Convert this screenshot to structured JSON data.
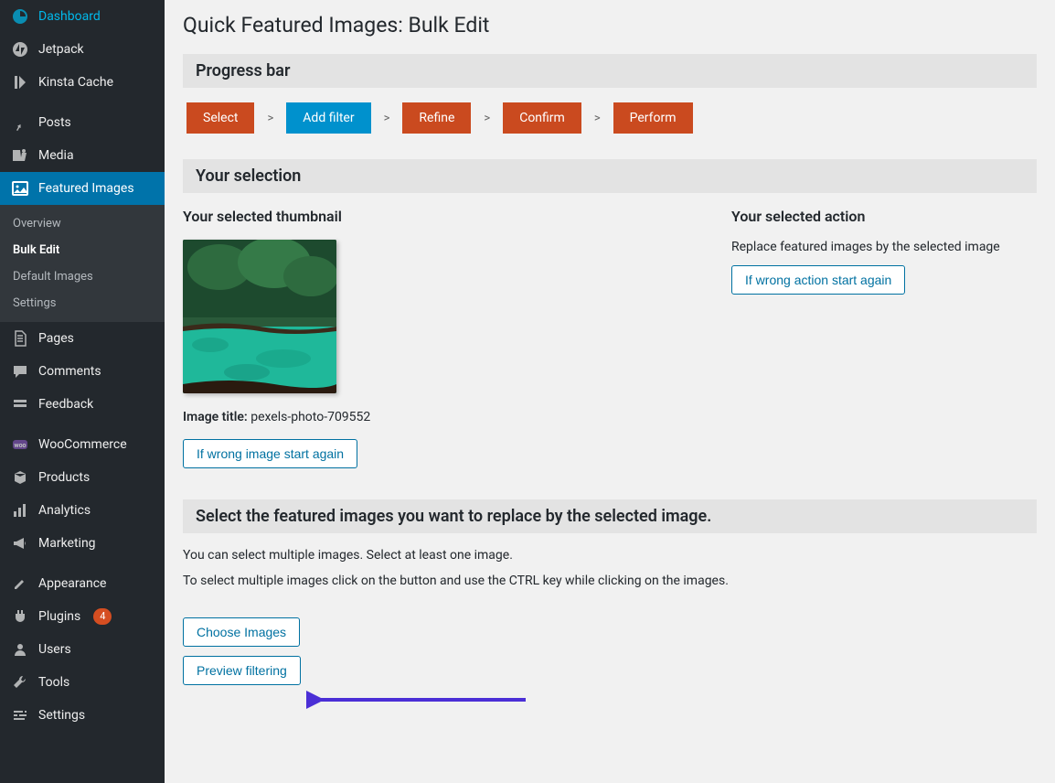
{
  "sidebar": {
    "items": [
      {
        "label": "Dashboard",
        "icon": "dashboard"
      },
      {
        "label": "Jetpack",
        "icon": "jetpack"
      },
      {
        "label": "Kinsta Cache",
        "icon": "kinsta"
      },
      {
        "label": "Posts",
        "icon": "pin"
      },
      {
        "label": "Media",
        "icon": "media"
      },
      {
        "label": "Featured Images",
        "icon": "featured",
        "active": true
      },
      {
        "label": "Pages",
        "icon": "pages"
      },
      {
        "label": "Comments",
        "icon": "comments"
      },
      {
        "label": "Feedback",
        "icon": "feedback"
      },
      {
        "label": "WooCommerce",
        "icon": "woo"
      },
      {
        "label": "Products",
        "icon": "products"
      },
      {
        "label": "Analytics",
        "icon": "analytics"
      },
      {
        "label": "Marketing",
        "icon": "marketing"
      },
      {
        "label": "Appearance",
        "icon": "appearance"
      },
      {
        "label": "Plugins",
        "icon": "plugins",
        "badge": "4"
      },
      {
        "label": "Users",
        "icon": "users"
      },
      {
        "label": "Tools",
        "icon": "tools"
      },
      {
        "label": "Settings",
        "icon": "settings"
      }
    ],
    "submenu": [
      {
        "label": "Overview"
      },
      {
        "label": "Bulk Edit",
        "current": true
      },
      {
        "label": "Default Images"
      },
      {
        "label": "Settings"
      }
    ]
  },
  "page": {
    "title": "Quick Featured Images: Bulk Edit",
    "progress_label": "Progress bar",
    "steps": [
      "Select",
      "Add filter",
      "Refine",
      "Confirm",
      "Perform"
    ],
    "active_step": "Add filter",
    "selection_header": "Your selection",
    "thumb_heading": "Your selected thumbnail",
    "image_title_label": "Image title:",
    "image_title_value": "pexels-photo-709552",
    "wrong_image_btn": "If wrong image start again",
    "action_heading": "Your selected action",
    "action_text": "Replace featured images by the selected image",
    "wrong_action_btn": "If wrong action start again",
    "replace_header": "Select the featured images you want to replace by the selected image.",
    "replace_desc1": "You can select multiple images. Select at least one image.",
    "replace_desc2": "To select multiple images click on the button and use the CTRL key while clicking on the images.",
    "choose_btn": "Choose Images",
    "preview_btn": "Preview filtering"
  }
}
